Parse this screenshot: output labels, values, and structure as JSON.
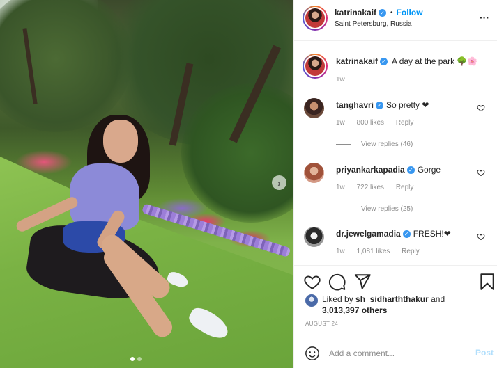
{
  "post": {
    "author": "katrinakaif",
    "follow_label": "Follow",
    "separator": "•",
    "location": "Saint Petersburg, Russia",
    "more_glyph": "···"
  },
  "caption": {
    "author": "katrinakaif",
    "text": "A day at the park 🌳🌸",
    "time": "1w"
  },
  "comments": [
    {
      "user": "tanghavri",
      "text": "So pretty ❤",
      "time": "1w",
      "likes": "800 likes",
      "reply_label": "Reply",
      "view_replies": "View replies (46)"
    },
    {
      "user": "priyankarkapadia",
      "text": "Gorge",
      "time": "1w",
      "likes": "722 likes",
      "reply_label": "Reply",
      "view_replies": "View replies (25)"
    },
    {
      "user": "dr.jewelgamadia",
      "text": "FRESH!❤",
      "time": "1w",
      "likes": "1,081 likes",
      "reply_label": "Reply"
    }
  ],
  "likes": {
    "prefix": "Liked by",
    "user": "sh_sidharththakur",
    "and": "and",
    "count": "3,013,397 others"
  },
  "date": "AUGUST 24",
  "add_comment": {
    "placeholder": "Add a comment...",
    "post_label": "Post"
  },
  "carousel": {
    "next_glyph": "›",
    "slides": 2,
    "active_slide": 1
  },
  "colors": {
    "accent": "#0095f6",
    "verified": "#3897f0",
    "muted": "#8e8e8e",
    "post_disabled": "#b2dffc"
  },
  "icons": [
    "verified-badge-icon",
    "more-options-icon",
    "heart-icon",
    "comment-icon",
    "share-icon",
    "bookmark-icon",
    "emoji-icon",
    "chevron-right-icon"
  ]
}
